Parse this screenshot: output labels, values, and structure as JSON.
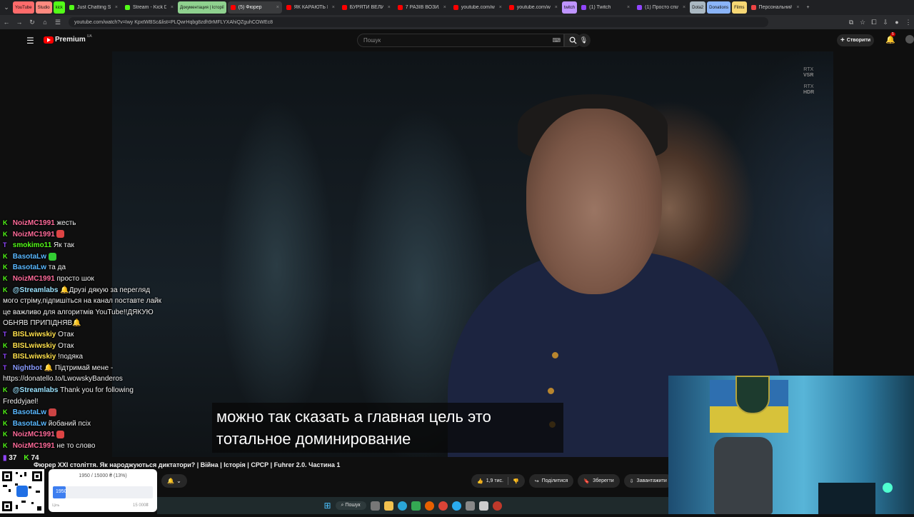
{
  "tabs": [
    {
      "label": "YouTube",
      "type": "bookmark",
      "color": "#ff6b6b"
    },
    {
      "label": "Studio",
      "type": "bookmark",
      "color": "#ff8a80"
    },
    {
      "label": "kick",
      "type": "bookmark",
      "color": "#53fc18"
    },
    {
      "label": "Just Chatting St",
      "type": "tab",
      "color": "#53fc18"
    },
    {
      "label": "Stream - Kick Da",
      "type": "tab",
      "color": "#53fc18"
    },
    {
      "label": "Документация | Історії",
      "type": "bookmark",
      "color": "#8fd18f"
    },
    {
      "label": "(5) Фюрер",
      "type": "tab",
      "color": "#ff0000",
      "active": true
    },
    {
      "label": "ЯК КАРАЮТЬ М",
      "type": "tab",
      "color": "#ff0000"
    },
    {
      "label": "БУРЯТИ ВЕЛИ",
      "type": "tab",
      "color": "#ff0000"
    },
    {
      "label": "7 РАЗІВ ВОЗИЛИ",
      "type": "tab",
      "color": "#ff0000"
    },
    {
      "label": "youtube.com/w",
      "type": "tab",
      "color": "#ff0000"
    },
    {
      "label": "youtube.com/w",
      "type": "tab",
      "color": "#ff0000"
    },
    {
      "label": "twitch",
      "type": "bookmark",
      "color": "#bf94ff"
    },
    {
      "label": "(1) Twitch",
      "type": "tab",
      "color": "#9146ff"
    },
    {
      "label": "(1) Просто спіл",
      "type": "tab",
      "color": "#9146ff"
    },
    {
      "label": "Dota2",
      "type": "bookmark",
      "color": "#aab8c2"
    },
    {
      "label": "Donations",
      "type": "bookmark",
      "color": "#8ab4f8"
    },
    {
      "label": "Films",
      "type": "bookmark",
      "color": "#f7d774"
    },
    {
      "label": "Персональний",
      "type": "tab",
      "color": "#e44"
    }
  ],
  "address": {
    "url": "youtube.com/watch?v=Iwy KpxtWBSc&list=PLQwrHqbg8zdh9rMFLYXAhiQZguhCOWEc8"
  },
  "yt": {
    "logo": "Premium",
    "logo_region": "UA",
    "search_placeholder": "Пошук",
    "create_label": "Створити",
    "notif_count": "5"
  },
  "video": {
    "subtitle_line1": "можно так сказать а главная цель это",
    "subtitle_line2": "тотальное доминирование",
    "overlay_vsr_top": "RTX",
    "overlay_vsr": "VSR",
    "overlay_hdr_top": "RTX",
    "overlay_hdr": "HDR",
    "title": "Фюрер XXI століття. Як народжуються диктатори? | Війна | Історія | СРСР | Fuhrer 2.0. Частина 1",
    "likes": "1,9 тис.",
    "share_label": "Поділитися",
    "save_label": "Зберегти",
    "download_label": "Завантажити"
  },
  "chat": {
    "messages": [
      {
        "src": "K",
        "src_color": "#53fc18",
        "user": "NoizMC1991",
        "user_color": "#ff6b9a",
        "text": "жесть",
        "emote": ""
      },
      {
        "src": "K",
        "src_color": "#53fc18",
        "user": "NoizMC1991",
        "user_color": "#ff6b9a",
        "text": "",
        "emote": "#d44"
      },
      {
        "src": "T",
        "src_color": "#9146ff",
        "user": "smokimo11",
        "user_color": "#53fc18",
        "text": "Як так",
        "emote": ""
      },
      {
        "src": "K",
        "src_color": "#53fc18",
        "user": "BasotaLw",
        "user_color": "#5ab8ff",
        "text": "",
        "emote": "#3c3"
      },
      {
        "src": "K",
        "src_color": "#53fc18",
        "user": "BasotaLw",
        "user_color": "#5ab8ff",
        "text": "та да",
        "emote": ""
      },
      {
        "src": "K",
        "src_color": "#53fc18",
        "user": "NoizMC1991",
        "user_color": "#ff6b9a",
        "text": "просто шок",
        "emote": ""
      },
      {
        "src": "K",
        "src_color": "#53fc18",
        "user": "@Streamlabs",
        "user_color": "#9be3ff",
        "text": "🔔Друзі дякую за перегляд мого стріму,підпишіться на канал поставте лайк це важливо для алгоритмів YouTube!!ДЯКУЮ ОБНЯВ ПРИПІДНЯВ🔔",
        "emote": ""
      },
      {
        "src": "T",
        "src_color": "#9146ff",
        "user": "BISLwiwskiy",
        "user_color": "#ffe14d",
        "text": "Отак",
        "emote": ""
      },
      {
        "src": "K",
        "src_color": "#53fc18",
        "user": "BISLwiwskiy",
        "user_color": "#ffe14d",
        "text": "Отак",
        "emote": ""
      },
      {
        "src": "T",
        "src_color": "#9146ff",
        "user": "BISLwiwskiy",
        "user_color": "#ffe14d",
        "text": "!подяка",
        "emote": ""
      },
      {
        "src": "T",
        "src_color": "#9146ff",
        "user": "Nightbot",
        "user_color": "#8a9cff",
        "text": "🔔 Підтримай мене - https://donatello.to/LwowskyBanderos",
        "emote": ""
      },
      {
        "src": "K",
        "src_color": "#53fc18",
        "user": "@Streamlabs",
        "user_color": "#9be3ff",
        "text": "Thank you for following Freddyjael!",
        "emote": ""
      },
      {
        "src": "K",
        "src_color": "#53fc18",
        "user": "BasotaLw",
        "user_color": "#5ab8ff",
        "text": "",
        "emote": "#c44"
      },
      {
        "src": "K",
        "src_color": "#53fc18",
        "user": "BasotaLw",
        "user_color": "#5ab8ff",
        "text": "йобаний псіх",
        "emote": ""
      },
      {
        "src": "K",
        "src_color": "#53fc18",
        "user": "NoizMC1991",
        "user_color": "#ff6b9a",
        "text": "",
        "emote": "#d44"
      },
      {
        "src": "K",
        "src_color": "#53fc18",
        "user": "NoizMC1991",
        "user_color": "#ff6b9a",
        "text": "не то слово",
        "emote": ""
      }
    ],
    "viewers_twitch": "37",
    "viewers_kick": "74"
  },
  "donation": {
    "progress_text": "1950 / 15000 ₴ (13%)",
    "bar_label": "1950",
    "progress_fraction": 0.13,
    "goal_label": "Ціль",
    "goal_value": "15 000₴"
  },
  "taskbar": {
    "search_label": "Пошук"
  }
}
